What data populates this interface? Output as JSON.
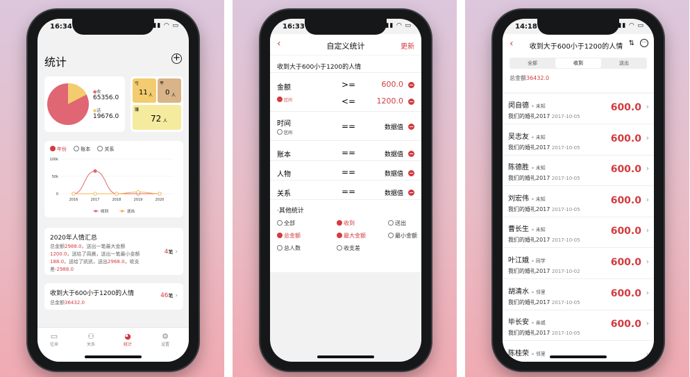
{
  "colors": {
    "accent": "#d33b3e",
    "pie_red": "#e06673",
    "pie_yellow": "#f3cc6f"
  },
  "phone1": {
    "time": "16:34",
    "title": "统计",
    "pie": {
      "legend_red": "收",
      "value_red": "65356.0",
      "legend_yellow": "送",
      "value_yellow": "19676.0"
    },
    "tiles": {
      "loss_label": "亏",
      "loss_count": "11",
      "loss_unit": "人",
      "even_label": "平",
      "even_count": "0",
      "even_unit": "人",
      "gain_label": "赚",
      "gain_count": "72",
      "gain_unit": "人"
    },
    "radios": [
      "年份",
      "账本",
      "关系"
    ],
    "chart_data": {
      "type": "line",
      "x": [
        "2016",
        "2017",
        "2018",
        "2019",
        "2020"
      ],
      "yticks": [
        "100k",
        "50k",
        "0"
      ],
      "ylim": [
        0,
        100000
      ],
      "series": [
        {
          "name": "收到",
          "color": "#e06673",
          "values": [
            0,
            65356,
            0,
            0,
            0
          ]
        },
        {
          "name": "送出",
          "color": "#f3b04a",
          "values": [
            0,
            0,
            0,
            5000,
            0
          ]
        }
      ]
    },
    "summary": {
      "title": "2020年人情汇总",
      "l1a": "总金额",
      "l1b": "2988.0",
      "l1c": "，送出一笔最大金额",
      "l2a": "1200.0",
      "l2b": "，送给了周晨，送出一笔最小金额",
      "l3a": "188.0",
      "l3b": "，送给了凯凯，送出",
      "l3c": "2968.0",
      "l3d": "，收支",
      "l4a": "差",
      "l4b": "-2988.0",
      "count": "4",
      "unit": "笔"
    },
    "custom": {
      "title": "收到大于600小于1200的人情",
      "total_label": "总金额",
      "total": "36432.0",
      "count": "46",
      "unit": "笔"
    },
    "tabs": [
      "往来",
      "关系",
      "统计",
      "设置"
    ]
  },
  "phone2": {
    "time": "16:33",
    "title": "自定义统计",
    "update": "更新",
    "query": "收到大于600小于1200的人情",
    "rows": [
      {
        "label": "金额",
        "op": ">=",
        "value": "600.0"
      },
      {
        "label": "区间",
        "op": "<=",
        "value": "1200.0"
      },
      {
        "label": "时间",
        "sub": "区间",
        "op": "==",
        "value": "数据值"
      },
      {
        "label": "账本",
        "op": "==",
        "value": "数据值"
      },
      {
        "label": "人物",
        "op": "==",
        "value": "数据值"
      },
      {
        "label": "关系",
        "op": "==",
        "value": "数据值"
      }
    ],
    "other_title": "·其他统计",
    "options": [
      {
        "label": "全部",
        "on": false
      },
      {
        "label": "收到",
        "on": true
      },
      {
        "label": "送出",
        "on": false
      },
      {
        "label": "总金额",
        "on": true
      },
      {
        "label": "最大金额",
        "on": true
      },
      {
        "label": "最小金额",
        "on": false
      },
      {
        "label": "总人数",
        "on": false
      },
      {
        "label": "收支差",
        "on": false
      }
    ]
  },
  "phone3": {
    "time": "14:18",
    "title": "收到大于600小于1200的人情",
    "segments": [
      "全部",
      "收到",
      "送出"
    ],
    "total_label": "总金额",
    "total": "36432.0",
    "items": [
      {
        "name": "闵自德",
        "rel": "未知",
        "event": "我们的婚礼2017",
        "date": "2017-10-05",
        "amount": "600.0"
      },
      {
        "name": "吴志友",
        "rel": "未知",
        "event": "我们的婚礼2017",
        "date": "2017-10-05",
        "amount": "600.0"
      },
      {
        "name": "陈德胜",
        "rel": "未知",
        "event": "我们的婚礼2017",
        "date": "2017-10-05",
        "amount": "600.0"
      },
      {
        "name": "刘宏伟",
        "rel": "未知",
        "event": "我们的婚礼2017",
        "date": "2017-10-05",
        "amount": "600.0"
      },
      {
        "name": "曹长生",
        "rel": "未知",
        "event": "我们的婚礼2017",
        "date": "2017-10-05",
        "amount": "600.0"
      },
      {
        "name": "叶江娥",
        "rel": "同学",
        "event": "我们的婚礼2017",
        "date": "2017-10-02",
        "amount": "600.0"
      },
      {
        "name": "胡清水",
        "rel": "邻里",
        "event": "我们的婚礼2017",
        "date": "2017-10-05",
        "amount": "600.0"
      },
      {
        "name": "毕长安",
        "rel": "亲戚",
        "event": "我们的婚礼2017",
        "date": "2017-10-05",
        "amount": "600.0"
      },
      {
        "name": "陈桂荣",
        "rel": "邻里",
        "event": "",
        "date": "",
        "amount": ""
      }
    ]
  }
}
